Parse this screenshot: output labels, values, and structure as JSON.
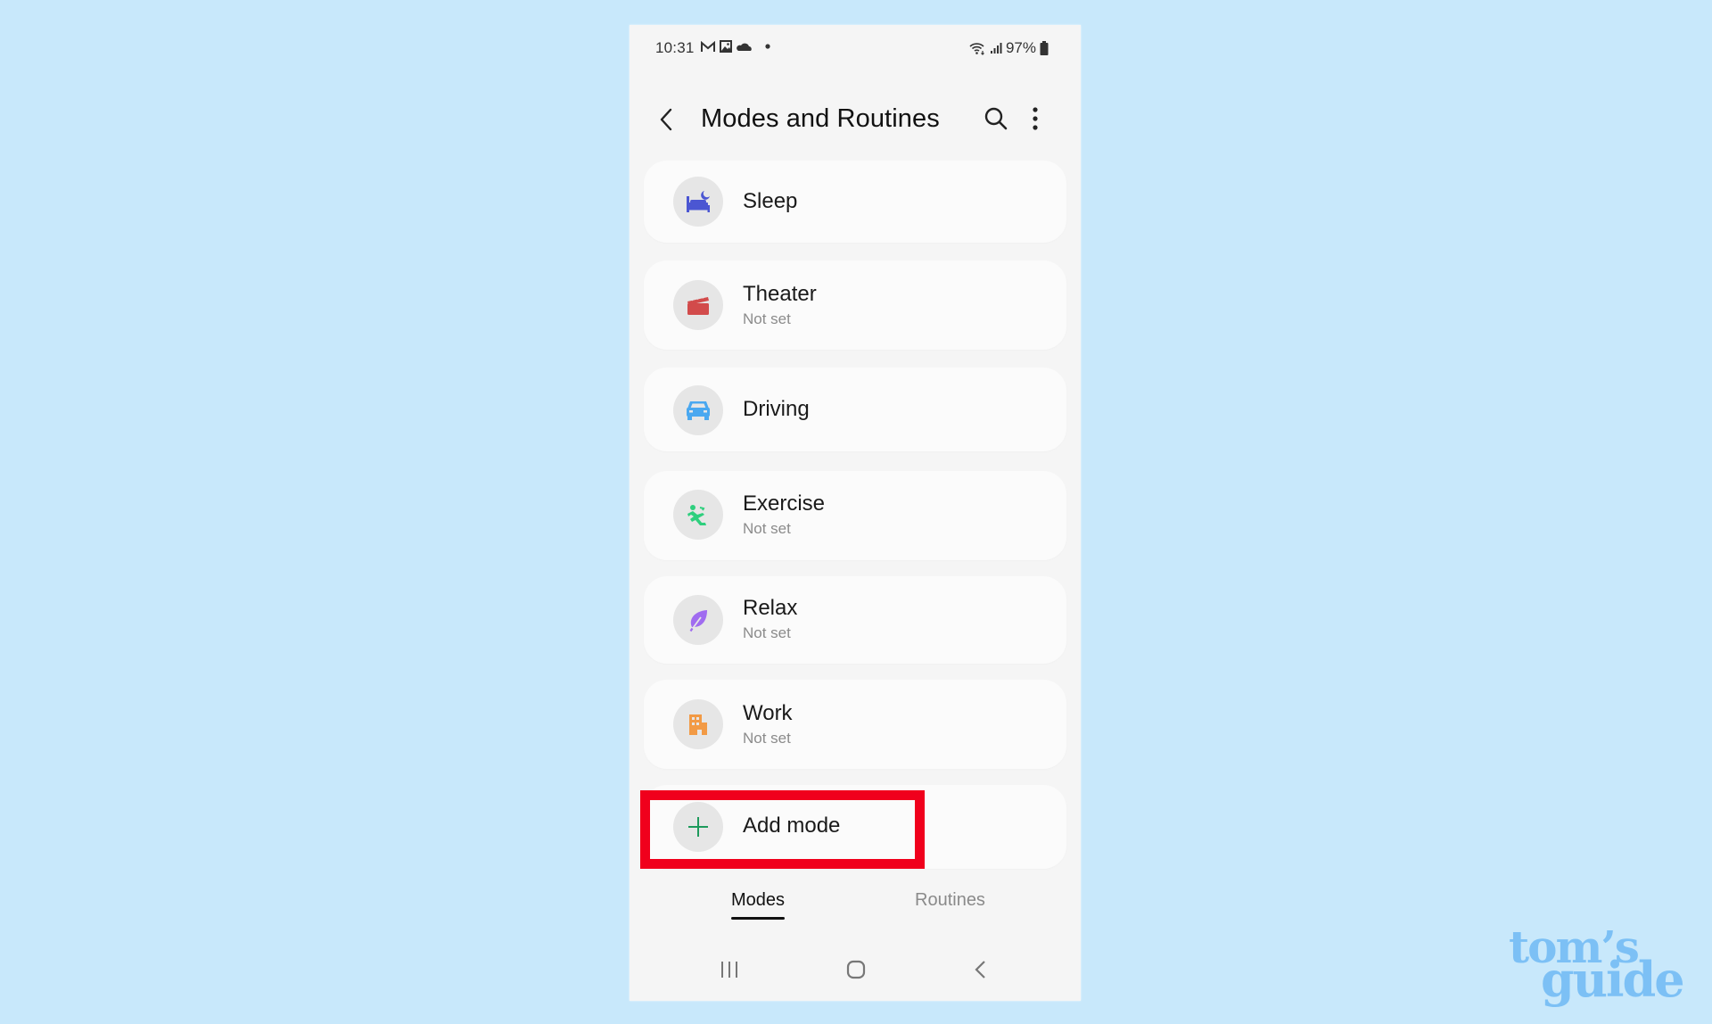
{
  "status_bar": {
    "time": "10:31",
    "notification_icons": [
      "gmail-icon",
      "gallery-icon",
      "cloud-icon",
      "dot-icon"
    ],
    "system_icons": [
      "wifi-icon",
      "signal-icon"
    ],
    "battery": "97%"
  },
  "header": {
    "title": "Modes and Routines",
    "back_icon": "chevron-left-icon",
    "search_icon": "search-icon",
    "more_icon": "more-vert-icon"
  },
  "modes": [
    {
      "name": "Sleep",
      "status": "",
      "icon": "bed-icon",
      "color": "#4b56d2"
    },
    {
      "name": "Theater",
      "status": "Not set",
      "icon": "clapperboard-icon",
      "color": "#d24b4b"
    },
    {
      "name": "Driving",
      "status": "",
      "icon": "car-icon",
      "color": "#4aa8f0"
    },
    {
      "name": "Exercise",
      "status": "Not set",
      "icon": "running-icon",
      "color": "#2fcf7e"
    },
    {
      "name": "Relax",
      "status": "Not set",
      "icon": "leaf-icon",
      "color": "#a06cf0"
    },
    {
      "name": "Work",
      "status": "Not set",
      "icon": "building-icon",
      "color": "#f29a45"
    }
  ],
  "add_mode": {
    "label": "Add mode",
    "icon": "plus-icon",
    "color": "#1e9a5c",
    "highlight_color": "#f0001c"
  },
  "tabs": [
    {
      "label": "Modes",
      "active": true
    },
    {
      "label": "Routines",
      "active": false
    }
  ],
  "nav_bar": [
    "recents-icon",
    "home-icon",
    "back-icon"
  ],
  "watermark": {
    "line1": "tom’s",
    "line2": "guide"
  }
}
